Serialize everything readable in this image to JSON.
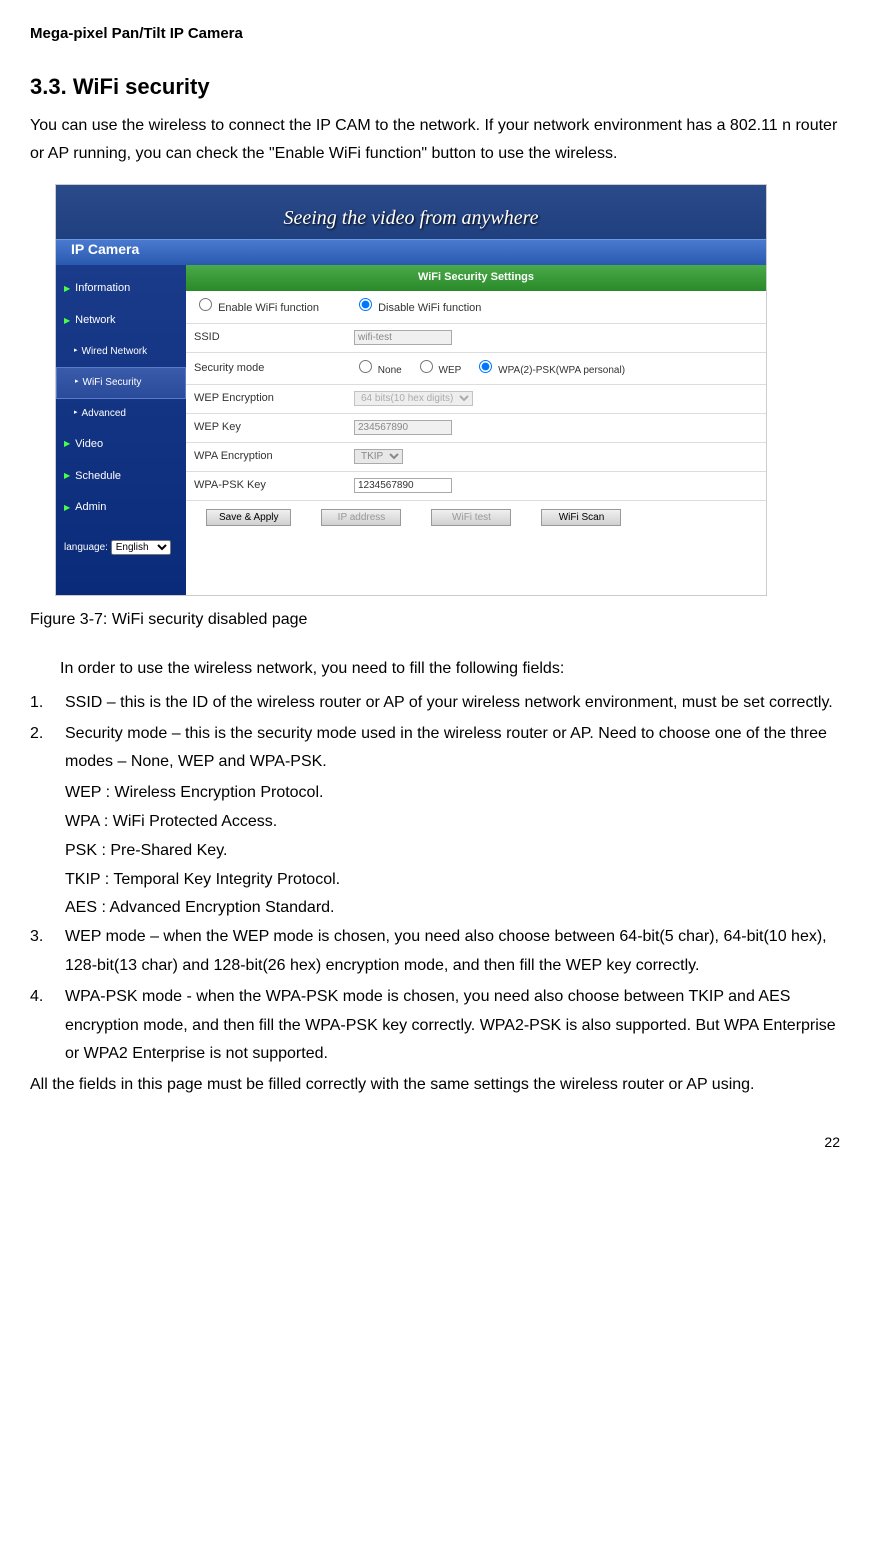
{
  "header": "Mega-pixel Pan/Tilt IP Camera",
  "section_number": "3.3.",
  "section_title": "WiFi security",
  "intro": "You can use the wireless to connect the IP CAM to the network. If your network environment has a 802.11 n router or AP running, you can check the \"Enable WiFi function\" button to use the wireless.",
  "screenshot": {
    "banner_text": "Seeing the video from anywhere",
    "camera_label": "IP Camera",
    "sidebar": {
      "items": [
        {
          "label": "Information",
          "type": "main"
        },
        {
          "label": "Network",
          "type": "main"
        },
        {
          "label": "Wired Network",
          "type": "sub"
        },
        {
          "label": "WiFi Security",
          "type": "sub",
          "selected": true
        },
        {
          "label": "Advanced",
          "type": "sub"
        },
        {
          "label": "Video",
          "type": "main"
        },
        {
          "label": "Schedule",
          "type": "main"
        },
        {
          "label": "Admin",
          "type": "main"
        }
      ],
      "language_label": "language:",
      "language_value": "English"
    },
    "content": {
      "header": "WiFi Security Settings",
      "enable_label": "Enable WiFi function",
      "disable_label": "Disable WiFi function",
      "rows": [
        {
          "label": "SSID",
          "value": "wifi-test",
          "type": "input"
        },
        {
          "label": "Security mode",
          "options": [
            "None",
            "WEP",
            "WPA(2)-PSK(WPA personal)"
          ],
          "type": "radio"
        },
        {
          "label": "WEP Encryption",
          "value": "64 bits(10 hex digits)",
          "type": "select"
        },
        {
          "label": "WEP Key",
          "value": "234567890",
          "type": "input"
        },
        {
          "label": "WPA Encryption",
          "value": "TKIP",
          "type": "select_small"
        },
        {
          "label": "WPA-PSK Key",
          "value": "1234567890",
          "type": "input_active"
        }
      ],
      "buttons": [
        {
          "label": "Save & Apply",
          "enabled": true
        },
        {
          "label": "IP address",
          "enabled": false
        },
        {
          "label": "WiFi test",
          "enabled": false
        },
        {
          "label": "WiFi Scan",
          "enabled": true
        }
      ]
    }
  },
  "figure_caption": "Figure 3-7: WiFi security disabled page",
  "list_intro": "In order to use the wireless network, you need to fill the following fields:",
  "items": [
    {
      "num": "1.",
      "text": "SSID – this is the ID of the wireless router or AP of your wireless network environment, must be set correctly."
    },
    {
      "num": "2.",
      "text": "Security mode – this is the security mode used in the wireless router or AP. Need to choose one of the three modes – None, WEP and WPA-PSK."
    }
  ],
  "defs": [
    "WEP : Wireless Encryption Protocol.",
    "WPA : WiFi Protected Access.",
    "PSK : Pre-Shared Key.",
    "TKIP : Temporal Key Integrity Protocol.",
    "AES : Advanced Encryption Standard."
  ],
  "items2": [
    {
      "num": "3.",
      "text": "WEP mode – when the WEP mode is chosen, you need also choose between 64-bit(5 char), 64-bit(10 hex), 128-bit(13 char) and 128-bit(26 hex) encryption mode, and then fill the WEP key correctly."
    },
    {
      "num": "4.",
      "text": "WPA-PSK mode - when the WPA-PSK mode is chosen, you need also choose between TKIP and AES encryption mode, and then fill the WPA-PSK key correctly. WPA2-PSK is also supported. But WPA Enterprise or WPA2 Enterprise is not supported."
    }
  ],
  "closing": "All the fields in this page must be filled correctly with the same settings the wireless router or AP using.",
  "page_number": "22"
}
